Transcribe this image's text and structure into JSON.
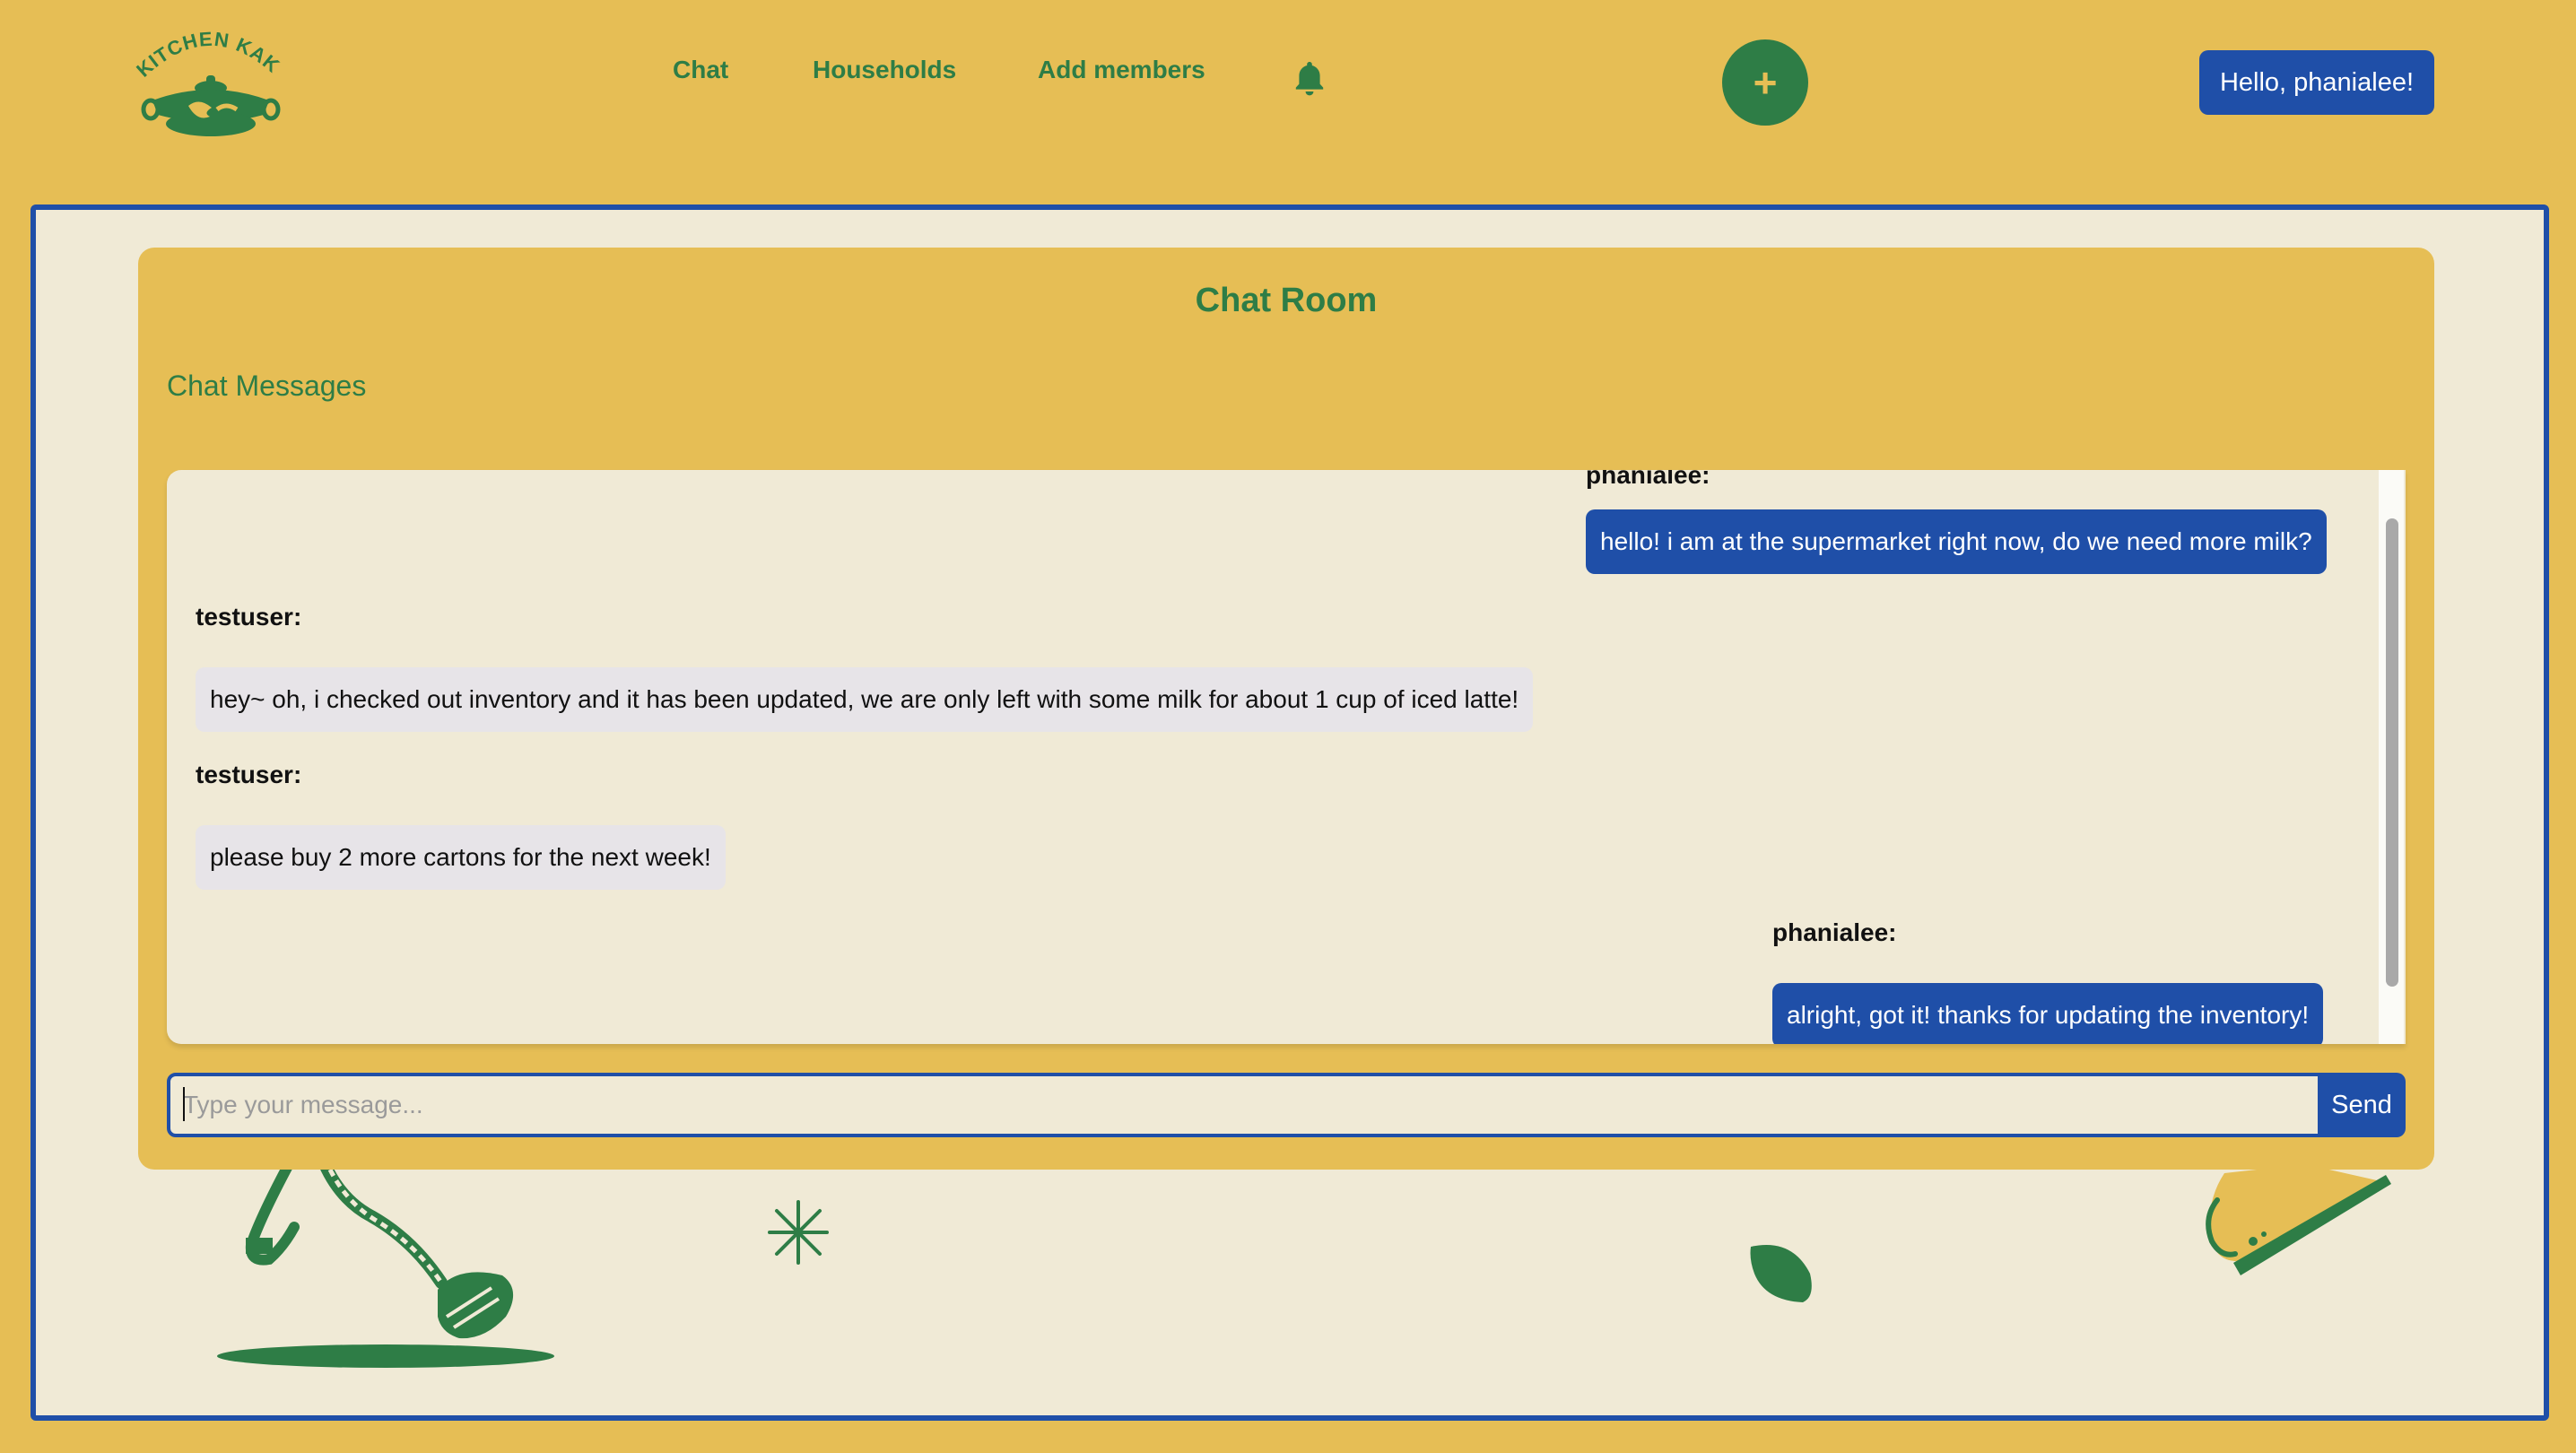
{
  "header": {
    "logo_text": "KITCHEN KAKI",
    "nav": [
      {
        "label": "Chat"
      },
      {
        "label": "Households"
      },
      {
        "label": "Add members"
      }
    ],
    "add_button_symbol": "+",
    "user_greeting": "Hello, phanialee!"
  },
  "chat": {
    "room_title": "Chat Room",
    "section_title": "Chat Messages",
    "messages": [
      {
        "sender": "phanialee:",
        "text": "hello! i am at the supermarket right now, do we need more milk?",
        "side": "right"
      },
      {
        "sender": "testuser:",
        "text": "hey~ oh, i checked out inventory and it has been updated, we are only left with some milk for about 1 cup of iced latte!",
        "side": "left"
      },
      {
        "sender": "testuser:",
        "text": "please buy 2 more cartons for the next week!",
        "side": "left"
      },
      {
        "sender": "phanialee:",
        "text": "alright, got it! thanks for updating the inventory!",
        "side": "right"
      }
    ],
    "input_placeholder": "Type your message...",
    "input_value": "",
    "send_label": "Send"
  },
  "colors": {
    "background": "#E6BE55",
    "brand_green": "#2E7D46",
    "brand_blue": "#1F4FA8",
    "cream": "#F0EAD6",
    "bubble_other": "#E7E4E8"
  },
  "icons": [
    "kitchen-kaki-logo",
    "bell-icon",
    "plus-icon"
  ]
}
